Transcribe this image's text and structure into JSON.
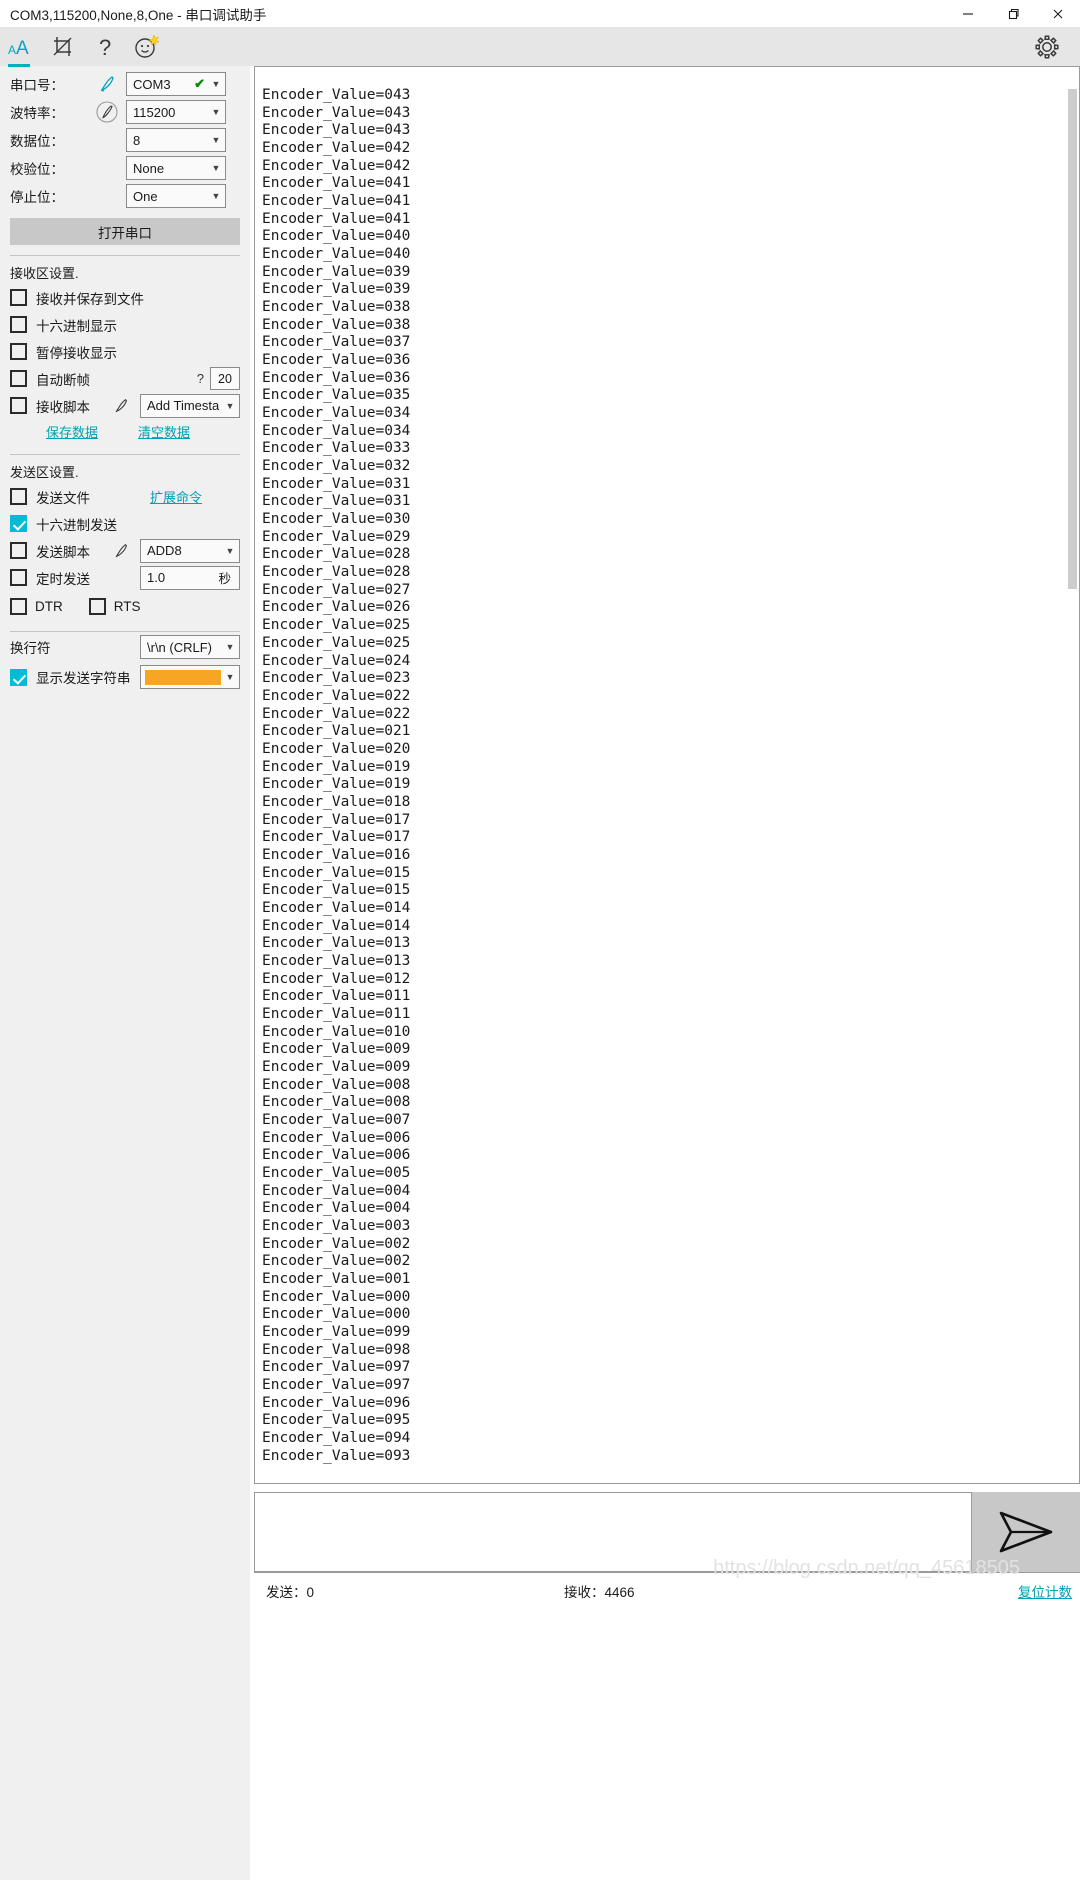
{
  "window": {
    "title": "COM3,115200,None,8,One - 串口调试助手",
    "minimize": "—",
    "maximize": "❐",
    "close": "✕"
  },
  "toolbar": {
    "font_icon": "font-size-icon",
    "crop_icon": "crop-icon",
    "help_icon": "help-icon",
    "help_glyph": "?",
    "emoji_icon": "smiley-icon",
    "gear_icon": "gear-icon"
  },
  "serial_settings": {
    "port": {
      "label": "串口号：",
      "value": "COM3"
    },
    "baud": {
      "label": "波特率：",
      "value": "115200"
    },
    "databits": {
      "label": "数据位：",
      "value": "8"
    },
    "parity": {
      "label": "校验位：",
      "value": "None"
    },
    "stopbits": {
      "label": "停止位：",
      "value": "One"
    },
    "open_button": "打开串口"
  },
  "receive_settings": {
    "title": "接收区设置.",
    "save_to_file": {
      "label": "接收并保存到文件",
      "checked": false
    },
    "hex_display": {
      "label": "十六进制显示",
      "checked": false
    },
    "pause_display": {
      "label": "暂停接收显示",
      "checked": false
    },
    "auto_frame": {
      "label": "自动断帧",
      "checked": false,
      "hint": "?",
      "value": "20"
    },
    "recv_script": {
      "label": "接收脚本",
      "checked": false,
      "value": "Add Timesta"
    },
    "save_data_link": "保存数据",
    "clear_data_link": "清空数据"
  },
  "send_settings": {
    "title": "发送区设置.",
    "send_file": {
      "label": "发送文件",
      "checked": false
    },
    "ext_command_link": "扩展命令",
    "hex_send": {
      "label": "十六进制发送",
      "checked": true
    },
    "send_script": {
      "label": "发送脚本",
      "checked": false,
      "value": "ADD8"
    },
    "timed_send": {
      "label": "定时发送",
      "checked": false,
      "value": "1.0",
      "unit": "秒"
    },
    "dtr": {
      "label": "DTR",
      "checked": false
    },
    "rts": {
      "label": "RTS",
      "checked": false
    }
  },
  "display_settings": {
    "newline": {
      "label": "换行符",
      "value": "\\r\\n (CRLF)"
    },
    "show_send_string": {
      "label": "显示发送字符串",
      "checked": true,
      "color": "#f5a623"
    }
  },
  "receive_area": {
    "lines": [
      "Encoder_Value=043",
      "Encoder_Value=043",
      "Encoder_Value=043",
      "Encoder_Value=042",
      "Encoder_Value=042",
      "Encoder_Value=041",
      "Encoder_Value=041",
      "Encoder_Value=041",
      "Encoder_Value=040",
      "Encoder_Value=040",
      "Encoder_Value=039",
      "Encoder_Value=039",
      "Encoder_Value=038",
      "Encoder_Value=038",
      "Encoder_Value=037",
      "Encoder_Value=036",
      "Encoder_Value=036",
      "Encoder_Value=035",
      "Encoder_Value=034",
      "Encoder_Value=034",
      "Encoder_Value=033",
      "Encoder_Value=032",
      "Encoder_Value=031",
      "Encoder_Value=031",
      "Encoder_Value=030",
      "Encoder_Value=029",
      "Encoder_Value=028",
      "Encoder_Value=028",
      "Encoder_Value=027",
      "Encoder_Value=026",
      "Encoder_Value=025",
      "Encoder_Value=025",
      "Encoder_Value=024",
      "Encoder_Value=023",
      "Encoder_Value=022",
      "Encoder_Value=022",
      "Encoder_Value=021",
      "Encoder_Value=020",
      "Encoder_Value=019",
      "Encoder_Value=019",
      "Encoder_Value=018",
      "Encoder_Value=017",
      "Encoder_Value=017",
      "Encoder_Value=016",
      "Encoder_Value=015",
      "Encoder_Value=015",
      "Encoder_Value=014",
      "Encoder_Value=014",
      "Encoder_Value=013",
      "Encoder_Value=013",
      "Encoder_Value=012",
      "Encoder_Value=011",
      "Encoder_Value=011",
      "Encoder_Value=010",
      "Encoder_Value=009",
      "Encoder_Value=009",
      "Encoder_Value=008",
      "Encoder_Value=008",
      "Encoder_Value=007",
      "Encoder_Value=006",
      "Encoder_Value=006",
      "Encoder_Value=005",
      "Encoder_Value=004",
      "Encoder_Value=004",
      "Encoder_Value=003",
      "Encoder_Value=002",
      "Encoder_Value=002",
      "Encoder_Value=001",
      "Encoder_Value=000",
      "Encoder_Value=000",
      "Encoder_Value=099",
      "Encoder_Value=098",
      "Encoder_Value=097",
      "Encoder_Value=097",
      "Encoder_Value=096",
      "Encoder_Value=095",
      "Encoder_Value=094",
      "Encoder_Value=093"
    ]
  },
  "send_area": {
    "value": "",
    "placeholder": "",
    "send_icon": "send-paper-plane-icon"
  },
  "statusbar": {
    "sent": "发送：0",
    "received": "接收：4466",
    "reset_link": "复位计数",
    "watermark": "https://blog.csdn.net/qq_45618505"
  }
}
